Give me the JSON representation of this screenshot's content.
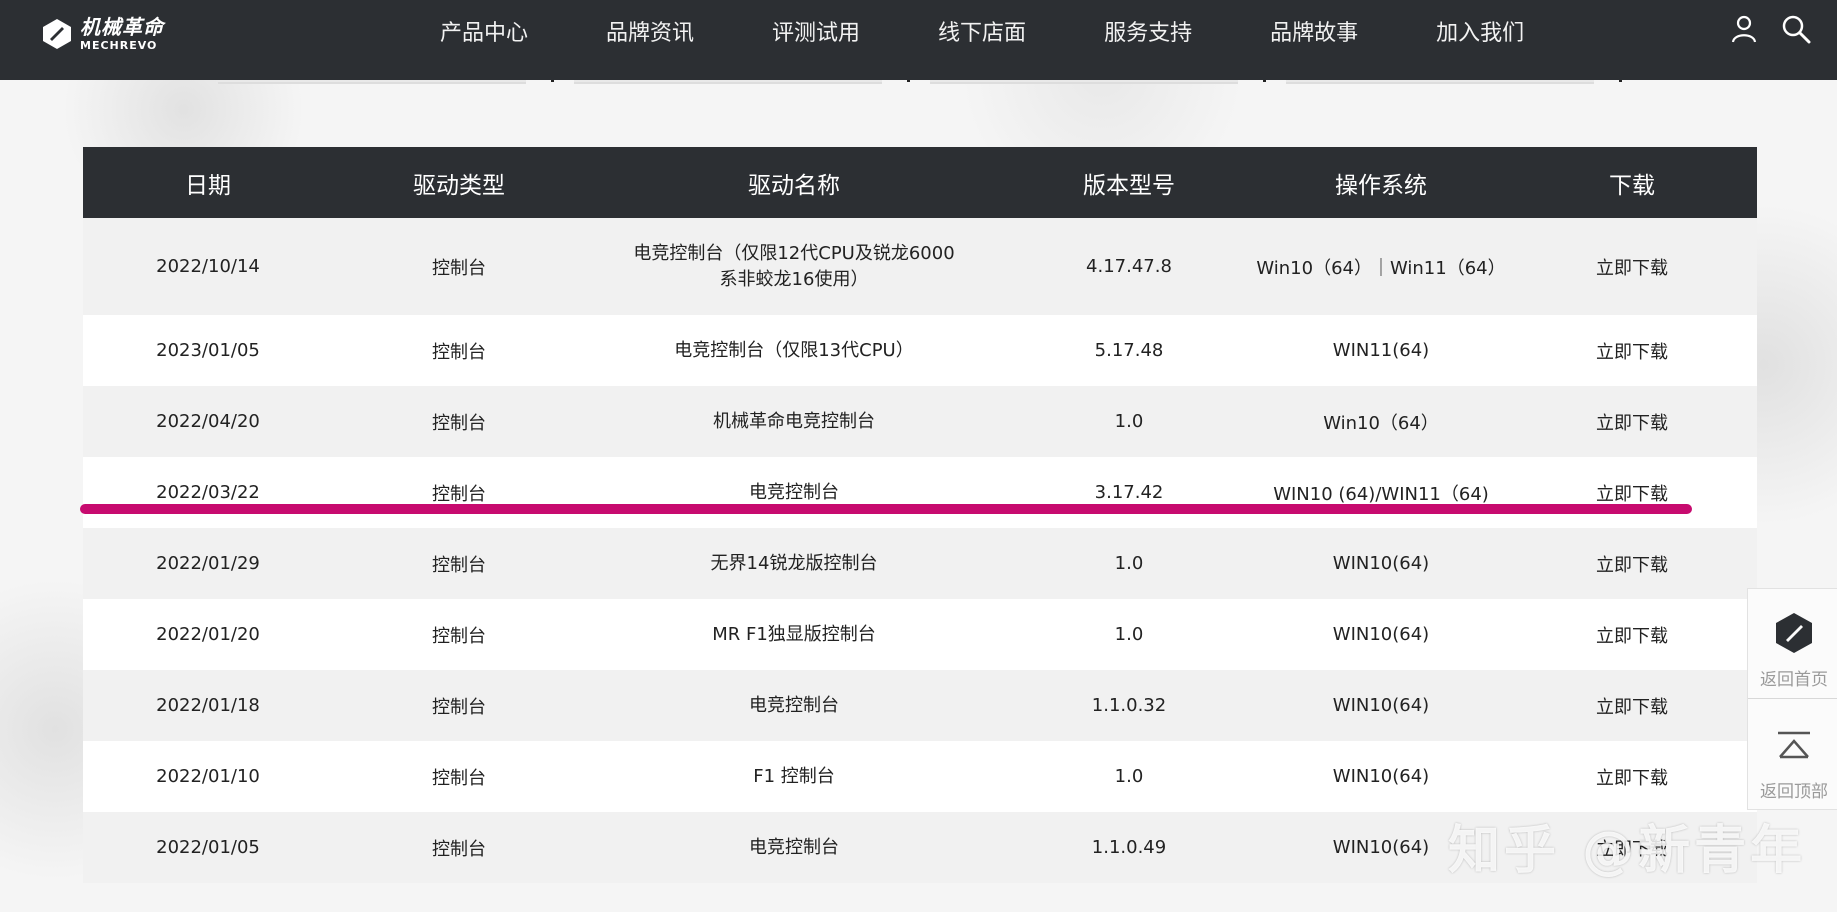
{
  "brand": {
    "cn": "机械革命",
    "en": "MECHREVO"
  },
  "nav": [
    "产品中心",
    "品牌资讯",
    "评测试用",
    "线下店面",
    "服务支持",
    "品牌故事",
    "加入我们"
  ],
  "header_icons": [
    "user-icon",
    "search-icon"
  ],
  "table": {
    "headers": [
      "日期",
      "驱动类型",
      "驱动名称",
      "版本型号",
      "操作系统",
      "下载"
    ],
    "rows": [
      [
        "2022/10/14",
        "控制台",
        "电竞控制台（仅限12代CPU及锐龙6000系非蛟龙16使用）",
        "4.17.47.8",
        "Win10（64）｜Win11（64）",
        "立即下载"
      ],
      [
        "2023/01/05",
        "控制台",
        "电竞控制台（仅限13代CPU）",
        "5.17.48",
        "WIN11(64)",
        "立即下载"
      ],
      [
        "2022/04/20",
        "控制台",
        "机械革命电竞控制台",
        "1.0",
        "Win10（64）",
        "立即下载"
      ],
      [
        "2022/03/22",
        "控制台",
        "电竞控制台",
        "3.17.42",
        "WIN10 (64)/WIN11（64)",
        "立即下载"
      ],
      [
        "2022/01/29",
        "控制台",
        "无界14锐龙版控制台",
        "1.0",
        "WIN10(64)",
        "立即下载"
      ],
      [
        "2022/01/20",
        "控制台",
        "MR F1独显版控制台",
        "1.0",
        "WIN10(64)",
        "立即下载"
      ],
      [
        "2022/01/18",
        "控制台",
        "电竞控制台",
        "1.1.0.32",
        "WIN10(64)",
        "立即下载"
      ],
      [
        "2022/01/10",
        "控制台",
        "F1 控制台",
        "1.0",
        "WIN10(64)",
        "立即下载"
      ],
      [
        "2022/01/05",
        "控制台",
        "电竞控制台",
        "1.1.0.49",
        "WIN10(64)",
        "立即下载"
      ]
    ]
  },
  "side_panel": {
    "home_label": "返回首页",
    "top_label": "返回顶部"
  },
  "watermark": "知乎 @新青年",
  "colors": {
    "header_bg": "#2c2f33",
    "highlight": "#c70b6f"
  }
}
